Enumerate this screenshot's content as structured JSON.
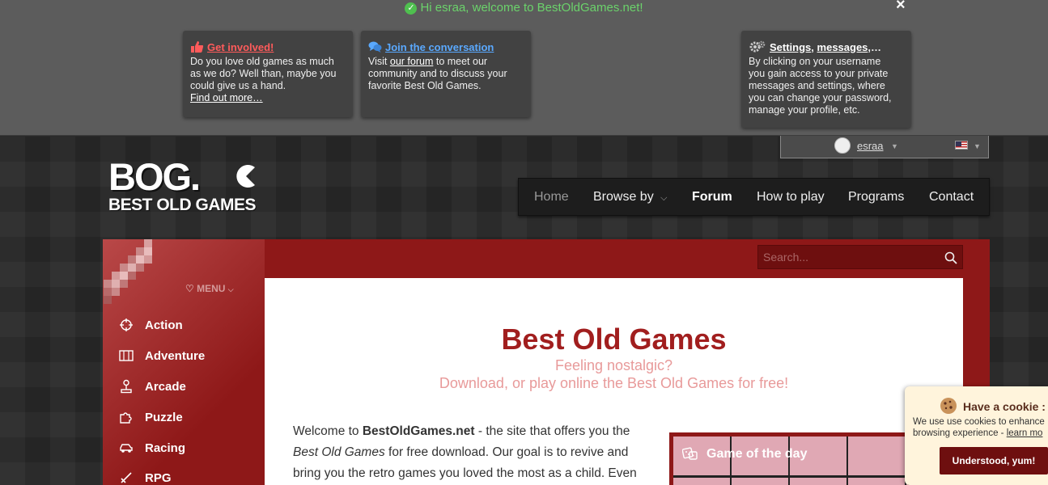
{
  "drawer": {
    "welcome_text": "Hi esraa, welcome to BestOldGames.net!",
    "close_label": "×",
    "cards": {
      "involved": {
        "title": "Get involved!",
        "line1": "Do you love old games as much",
        "line2": "as we do? Well than, maybe you",
        "line3": "could give us a hand.",
        "link": "Find out more…"
      },
      "conversation": {
        "title": "Join the conversation",
        "pre": "Visit ",
        "link": "our forum",
        "post": " to meet our",
        "line2": "community and to discuss your",
        "line3": "favorite Best Old Games."
      },
      "settings": {
        "title_a": "Settings",
        "title_sep": ", ",
        "title_b": "messages",
        "title_end": ",…",
        "line1": "By clicking on your username",
        "line2": "you gain access to your private",
        "line3": "messages and settings, where",
        "line4": "you can change your password,",
        "line5": "manage your profile, etc."
      }
    },
    "user": {
      "name": "esraa"
    }
  },
  "logo": {
    "big": "BOG.",
    "small": "BEST OLD GAMES"
  },
  "nav": {
    "home": "Home",
    "browse": "Browse by",
    "forum": "Forum",
    "how": "How to play",
    "programs": "Programs",
    "contact": "Contact"
  },
  "search": {
    "placeholder": "Search..."
  },
  "sidebar": {
    "menu_label": "MENU",
    "items": [
      "Action",
      "Adventure",
      "Arcade",
      "Puzzle",
      "Racing",
      "RPG"
    ]
  },
  "main": {
    "title": "Best Old Games",
    "subtitle1": "Feeling nostalgic?",
    "subtitle2": "Download, or play online the Best Old Games for free!",
    "intro": {
      "p1": "Welcome to ",
      "site": "BestOldGames.net",
      "p2": " - the site that offers you the",
      "em": "Best Old Games",
      "p3": " for free download. Our goal is to revive and",
      "p4": "bring you the retro games you loved the most as a child. Even"
    },
    "gotd": "Game of the day"
  },
  "cookie": {
    "title": "Have a cookie :",
    "line1": "We use use cookies to enhance",
    "line2_pre": "browsing experience - ",
    "line2_link": "learn mo",
    "button": "Understood, yum!"
  },
  "colors": {
    "accent_red": "#8e1818",
    "title_red": "#a11e1e",
    "welcome_green": "#6bd36b"
  }
}
